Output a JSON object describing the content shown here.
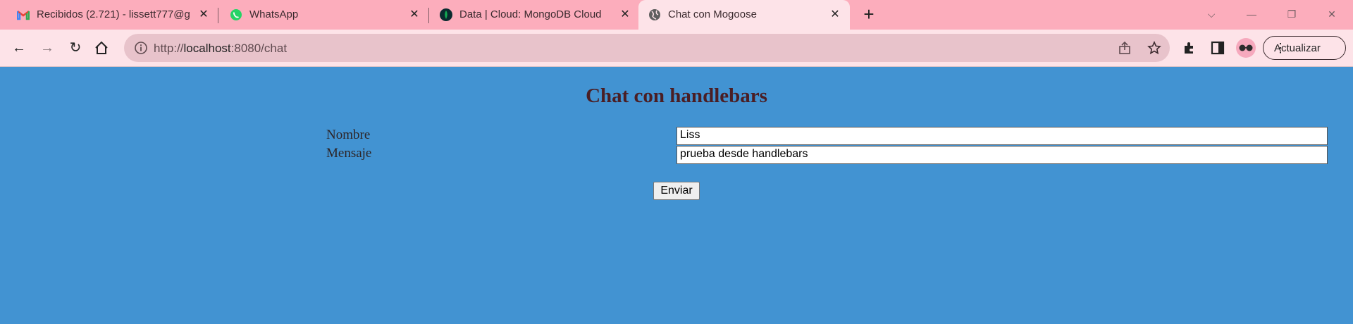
{
  "browser": {
    "tabs": [
      {
        "title": "Recibidos (2.721) - lissett777@g",
        "icon": "gmail-icon",
        "active": false
      },
      {
        "title": "WhatsApp",
        "icon": "whatsapp-icon",
        "active": false
      },
      {
        "title": "Data | Cloud: MongoDB Cloud",
        "icon": "mongodb-icon",
        "active": false
      },
      {
        "title": "Chat con Mogoose",
        "icon": "globe-icon",
        "active": true
      }
    ],
    "url": {
      "prefix": "http://",
      "host": "localhost",
      "rest": ":8080/chat"
    },
    "update_label": "Actualizar",
    "colors": {
      "tabstrip": "#fcadbc",
      "toolbar": "#fde3e8",
      "omnibox": "#e8c3cb"
    }
  },
  "page": {
    "title": "Chat con handlebars",
    "name_label": "Nombre",
    "name_value": "Liss",
    "message_label": "Mensaje",
    "message_value": "prueba desde handlebars",
    "send_label": "Enviar",
    "colors": {
      "background": "#4293d2",
      "title": "#4a1e24"
    }
  }
}
